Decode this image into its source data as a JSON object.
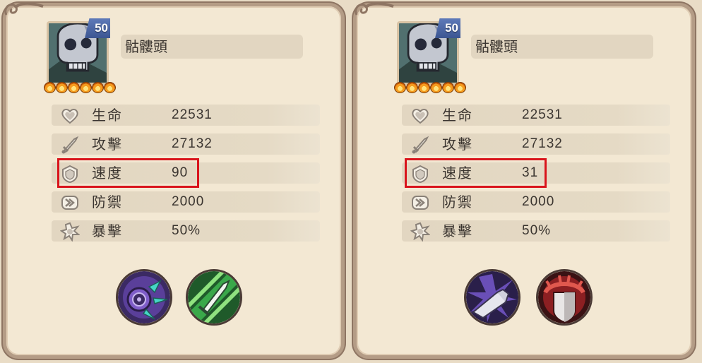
{
  "panels": [
    {
      "level": "50",
      "name": "骷髏頭",
      "stats": [
        {
          "label": "生命",
          "value": "22531",
          "icon": "heart-icon"
        },
        {
          "label": "攻擊",
          "value": "27132",
          "icon": "sword-icon"
        },
        {
          "label": "速度",
          "value": "90",
          "icon": "shield-icon"
        },
        {
          "label": "防禦",
          "value": "2000",
          "icon": "chevron-icon"
        },
        {
          "label": "暴擊",
          "value": "50%",
          "icon": "burst-icon"
        }
      ],
      "stars": 6,
      "highlighted_stat": "速度",
      "skills": [
        "spiked-orb-skill-icon",
        "green-dagger-skill-icon"
      ]
    },
    {
      "level": "50",
      "name": "骷髏頭",
      "stats": [
        {
          "label": "生命",
          "value": "22531",
          "icon": "heart-icon"
        },
        {
          "label": "攻擊",
          "value": "27132",
          "icon": "sword-icon"
        },
        {
          "label": "速度",
          "value": "31",
          "icon": "shield-icon"
        },
        {
          "label": "防禦",
          "value": "2000",
          "icon": "chevron-icon"
        },
        {
          "label": "暴擊",
          "value": "50%",
          "icon": "burst-icon"
        }
      ],
      "stars": 6,
      "highlighted_stat": "速度",
      "skills": [
        "fist-strike-skill-icon",
        "red-shield-skill-icon"
      ]
    }
  ],
  "colors": {
    "panel_bg": "#f3e8d3",
    "panel_border": "#b49c86",
    "stat_bar": "#e2d6c1",
    "highlight": "#d9141c",
    "level_badge": "#4a66a3"
  }
}
